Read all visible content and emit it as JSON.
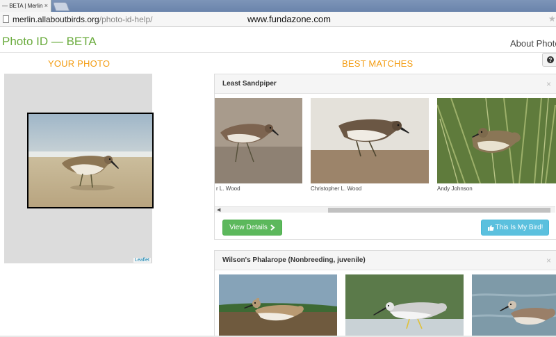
{
  "browser": {
    "tab_title": "— BETA | Merlin",
    "tab_close": "×",
    "url_host": "merlin.allaboutbirds.org",
    "url_path": "/photo-id-help/",
    "watermark": "www.fundazone.com"
  },
  "header": {
    "title": "Photo ID — BETA",
    "about_link": "About Photo",
    "help_glyph": "?"
  },
  "your_photo": {
    "heading": "YOUR PHOTO",
    "attribution": "Leaflet"
  },
  "best_matches": {
    "heading": "BEST MATCHES",
    "cards": [
      {
        "species": "Least Sandpiper",
        "close": "×",
        "credits": [
          "r L. Wood",
          "Christopher L. Wood",
          "Andy Johnson"
        ],
        "view_details_label": "View Details",
        "this_is_my_bird_label": "This Is My Bird!"
      },
      {
        "species": "Wilson's Phalarope (Nonbreeding, juvenile)",
        "close": "×"
      }
    ]
  },
  "icons": {
    "page": "page-icon",
    "star": "bookmark-star-icon",
    "help": "question-circle-icon",
    "chevron": "chevron-right-icon",
    "thumbs_up": "thumbs-up-icon"
  },
  "colors": {
    "title_green": "#6aab3d",
    "heading_orange": "#f39c12",
    "button_green": "#5cb85c",
    "button_blue": "#5bc0de"
  }
}
